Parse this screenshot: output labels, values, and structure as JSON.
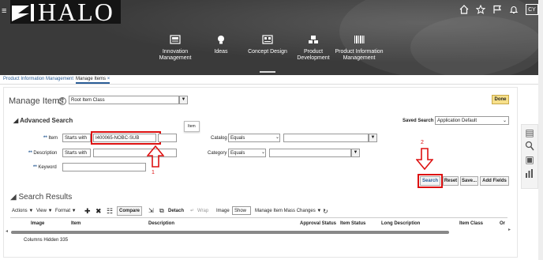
{
  "header": {
    "logo_text": "HALO",
    "avatar_initials": "CY",
    "icons": [
      "home-icon",
      "star-icon",
      "flag-icon",
      "bell-icon"
    ]
  },
  "nav": {
    "items": [
      {
        "label": "Innovation\nManagement",
        "icon": "innovation-icon"
      },
      {
        "label": "Ideas",
        "icon": "lightbulb-icon"
      },
      {
        "label": "Concept Design",
        "icon": "concept-design-icon"
      },
      {
        "label": "Product\nDevelopment",
        "icon": "product-development-icon"
      },
      {
        "label": "Product Information\nManagement",
        "icon": "barcode-icon"
      }
    ]
  },
  "tabs": {
    "pim": "Product Information Management",
    "manage_items": "Manage Items",
    "close": "×"
  },
  "page": {
    "title": "Manage Items",
    "help": "?",
    "root_item_class": "Root Item Class",
    "done": "Done",
    "advanced_search": "Advanced Search",
    "saved_search_label": "Saved Search",
    "saved_search_value": "Application Default"
  },
  "form": {
    "req_mark": "**",
    "item_label": "Item",
    "item_op": "Starts with",
    "item_value": "I400065-NOBC-SUB",
    "description_label": "Description",
    "description_op": "Starts with",
    "keyword_label": "Keyword",
    "catalog_label": "Catalog",
    "catalog_op": "Equals",
    "category_label": "Category",
    "category_op": "Equals",
    "tooltip": "Item"
  },
  "buttons": {
    "search": "Search",
    "reset": "Reset",
    "save": "Save...",
    "add_fields": "Add Fields"
  },
  "annotations": {
    "one": "1",
    "two": "2"
  },
  "results": {
    "title": "Search Results",
    "toolbar": {
      "actions": "Actions ▼",
      "view": "View ▼",
      "format": "Format ▼",
      "compare": "Compare",
      "detach": "Detach",
      "wrap": "Wrap",
      "image": "Image",
      "show": "Show",
      "mass_changes": "Manage Item Mass Changes ▼"
    },
    "columns": [
      "Image",
      "Item",
      "Description",
      "Approval Status",
      "Item Status",
      "Long Description",
      "Item Class",
      "Or"
    ],
    "columns_hidden": "Columns Hidden  335"
  },
  "colors": {
    "banner": "#3a3a3a",
    "link": "#2b5e97",
    "annotation_red": "#dd1111",
    "done_button": "#f7e08a"
  }
}
